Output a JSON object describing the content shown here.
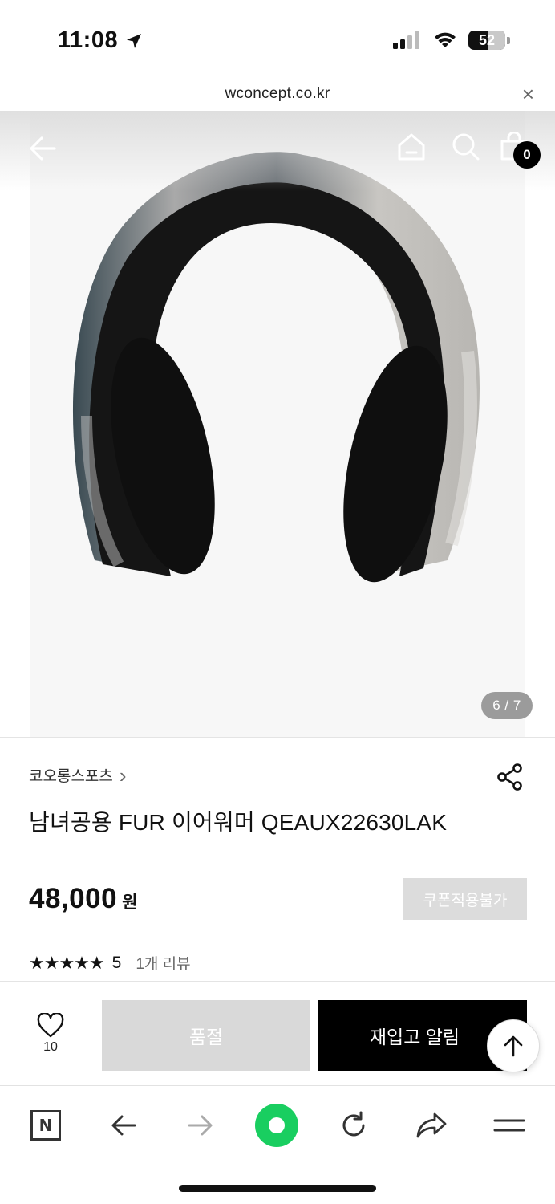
{
  "status": {
    "time": "11:08",
    "battery": "52"
  },
  "browser": {
    "url": "wconcept.co.kr",
    "close": "×"
  },
  "header": {
    "cart_count": "0"
  },
  "gallery": {
    "indicator": "6 / 7"
  },
  "product": {
    "brand": "코오롱스포츠",
    "brand_chevron": "›",
    "title": "남녀공용 FUR 이어워머 QEAUX22630LAK",
    "price": "48,000",
    "currency": "원",
    "coupon_label": "쿠폰적용불가",
    "stars": "★★★★★",
    "rating": "5",
    "review_link": "1개 리뷰"
  },
  "purchase_bar": {
    "wish_count": "10",
    "soldout_label": "품절",
    "restock_label": "재입고 알림"
  },
  "colors": {
    "accent_green": "#19ce60",
    "disabled_gray": "#d9d9d9",
    "primary_black": "#000000"
  }
}
